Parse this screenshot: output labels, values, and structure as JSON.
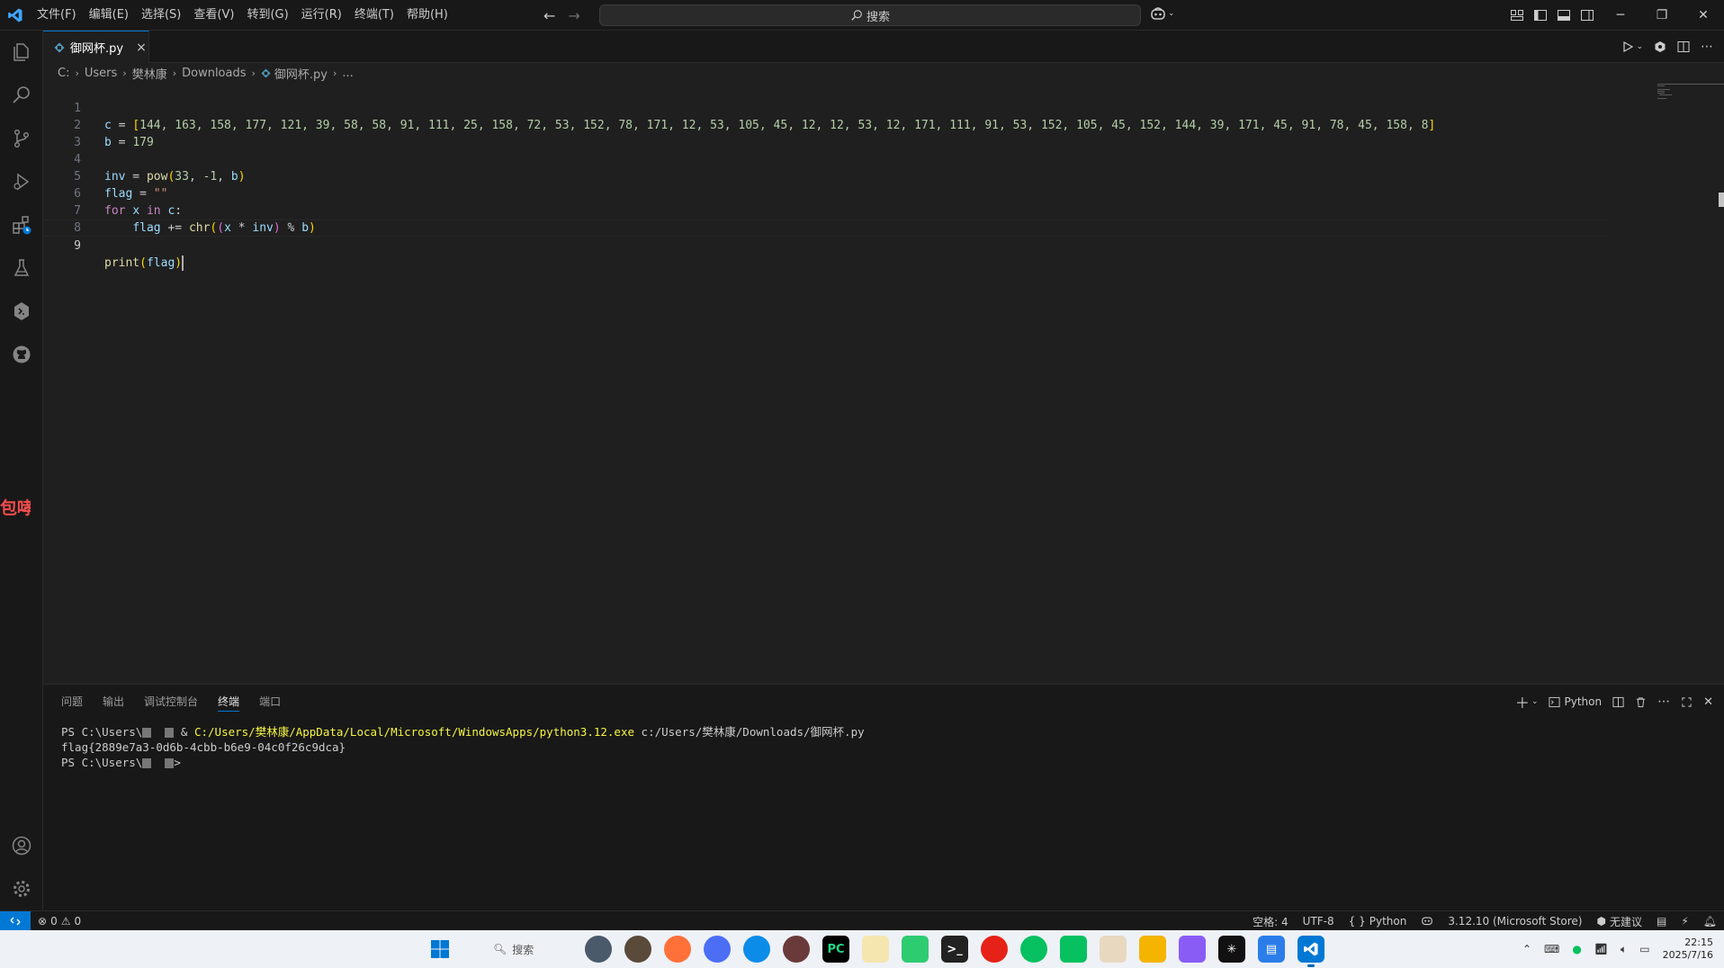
{
  "menu": [
    "文件(F)",
    "编辑(E)",
    "选择(S)",
    "查看(V)",
    "转到(G)",
    "运行(R)",
    "终端(T)",
    "帮助(H)"
  ],
  "search": {
    "placeholder": "搜索"
  },
  "tab": {
    "filename": "御网杯.py",
    "close": "×"
  },
  "breadcrumb": [
    "C:",
    "Users",
    "樊林康",
    "Downloads",
    "御网杯.py",
    "..."
  ],
  "code": {
    "line_numbers": [
      "1",
      "2",
      "3",
      "4",
      "5",
      "6",
      "7",
      "8",
      "9"
    ],
    "c_values": "144, 163, 158, 177, 121, 39, 58, 58, 91, 111, 25, 158, 72, 53, 152, 78, 171, 12, 53, 105, 45, 12, 12, 53, 12, 171, 111, 91, 53, 152, 105, 45, 152, 144, 39, 171, 45, 91, 78, 45, 158, 8"
  },
  "panel": {
    "tabs": [
      "问题",
      "输出",
      "调试控制台",
      "终端",
      "端口"
    ],
    "active_tab": "终端",
    "shell_label": "Python",
    "terminal": {
      "line1_prefix": "PS C:\\Users\\",
      "line1_cmd": "& ",
      "line1_exe": "C:/Users/樊林康/AppData/Local/Microsoft/WindowsApps/python3.12.exe",
      "line1_arg": " c:/Users/樊林康/Downloads/御网杯.py",
      "line2": "flag{2889e7a3-0d6b-4cbb-b6e9-04c0f26c9dca}",
      "line3_prefix": "PS C:\\Users\\",
      "line3_suffix": ">"
    }
  },
  "status": {
    "errors": "0",
    "warnings": "0",
    "spaces": "空格: 4",
    "encoding": "UTF-8",
    "language": "Python",
    "interpreter": "3.12.10 (Microsoft Store)",
    "suggest": "无建议"
  },
  "sidebar_peek": "包哮",
  "taskbar": {
    "search": "搜索"
  },
  "clock": {
    "time": "22:15",
    "date": "2025/7/16"
  },
  "colors": {
    "accent": "#0078d4",
    "editor_bg": "#1f1f1f",
    "chrome_bg": "#181818",
    "terminal_path": "#f5f543"
  }
}
